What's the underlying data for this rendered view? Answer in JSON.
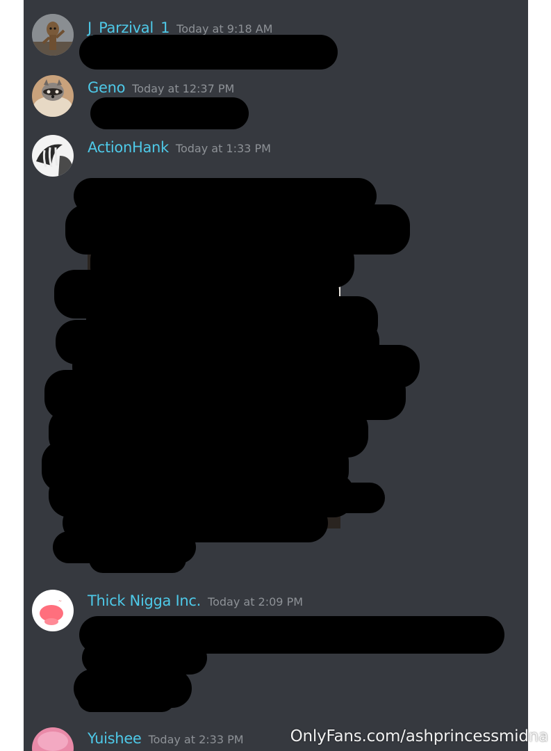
{
  "channel": {
    "messages": [
      {
        "username": "J_Parzival_1",
        "timestamp": "Today at 9:18 AM",
        "avatar_icon": "groot-avatar-icon"
      },
      {
        "username": "Geno",
        "timestamp": "Today at 12:37 PM",
        "avatar_icon": "raccoon-avatar-icon"
      },
      {
        "username": "ActionHank",
        "timestamp": "Today at 1:33 PM",
        "avatar_icon": "claw-avatar-icon"
      },
      {
        "username": "Thick Nigga Inc.",
        "timestamp": "Today at 2:09 PM",
        "avatar_icon": "pink-blob-avatar-icon"
      },
      {
        "username": "Yuishee",
        "timestamp": "Today at 2:33 PM",
        "avatar_icon": "pink-hair-avatar-icon"
      }
    ]
  },
  "watermark": "OnlyFans.com/ashprincessmidna",
  "colors": {
    "background": "#36393f",
    "username": "#4ec9e8",
    "timestamp": "#8e9297",
    "redaction": "#000000"
  }
}
